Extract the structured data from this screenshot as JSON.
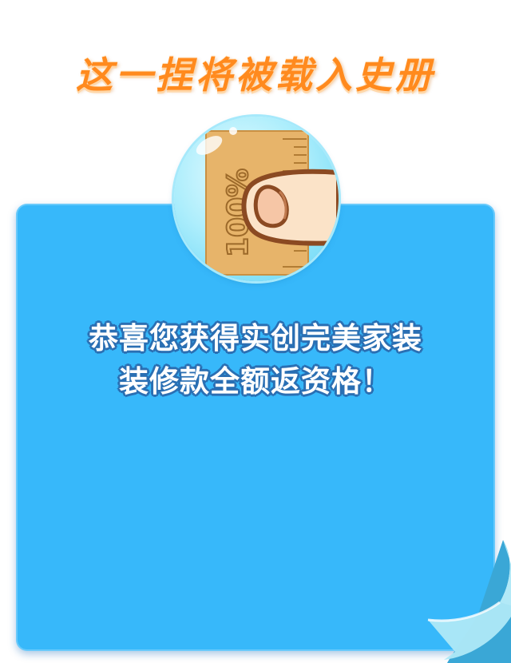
{
  "headline": {
    "text": "这一捏将被载入史册"
  },
  "badge": {
    "ruler_text": "100%",
    "icon": "pinching-finger-ruler-icon"
  },
  "card": {
    "message_line1": "恭喜您获得实创完美家装",
    "message_line2": "装修款全额返资格！"
  },
  "colors": {
    "headline": "#ff8a1e",
    "card": "#37b8fa",
    "text_outline": "#2a6fb3",
    "ribbon": "#7fd3ef"
  }
}
